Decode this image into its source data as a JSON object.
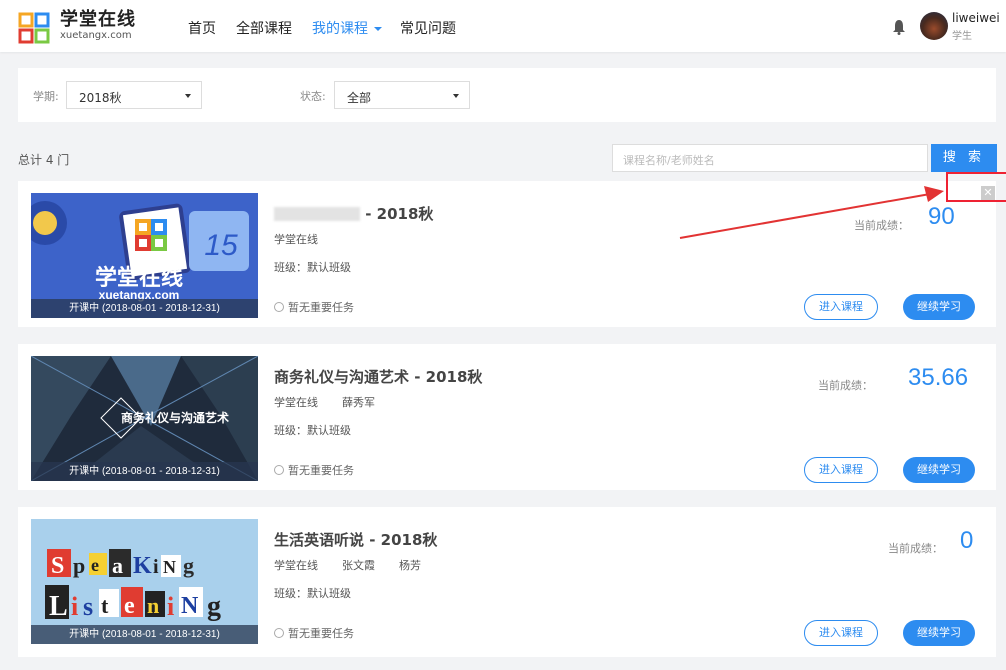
{
  "brand": {
    "name_cn": "学堂在线",
    "domain": "xuetangx.com"
  },
  "nav": {
    "items": [
      "首页",
      "全部课程",
      "我的课程",
      "常见问题"
    ],
    "active": "我的课程"
  },
  "user": {
    "name": "liweiwei",
    "role": "学生"
  },
  "filters": {
    "term_label": "学期:",
    "term_value": "2018秋",
    "status_label": "状态:",
    "status_value": "全部"
  },
  "summary": {
    "total": "总计 4 门"
  },
  "search": {
    "placeholder": "课程名称/老师姓名",
    "button": "搜 索"
  },
  "labels": {
    "score": "当前成绩：",
    "enter": "进入课程",
    "continue": "继续学习",
    "no_task": "暂无重要任务"
  },
  "courses": [
    {
      "title": "- 2018秋",
      "teachers": [
        "学堂在线"
      ],
      "class": "班级：默认班级",
      "period": "开课中 (2018-08-01 - 2018-12-31)",
      "score": "90"
    },
    {
      "title": "商务礼仪与沟通艺术 - 2018秋",
      "teachers": [
        "学堂在线",
        "薛秀军"
      ],
      "class": "班级：默认班级",
      "period": "开课中 (2018-08-01 - 2018-12-31)",
      "score": "35.66",
      "thumb_text": "商务礼仪与沟通艺术"
    },
    {
      "title": "生活英语听说 - 2018秋",
      "teachers": [
        "学堂在线",
        "张文霞",
        "杨芳"
      ],
      "class": "班级：默认班级",
      "period": "开课中 (2018-08-01 - 2018-12-31)",
      "score": "0"
    }
  ],
  "thumb1": {
    "number": "15",
    "cn": "学堂在线",
    "en": "xuetangx.com"
  },
  "colors": {
    "accent": "#2d8cf0",
    "annotation": "#e23333"
  }
}
